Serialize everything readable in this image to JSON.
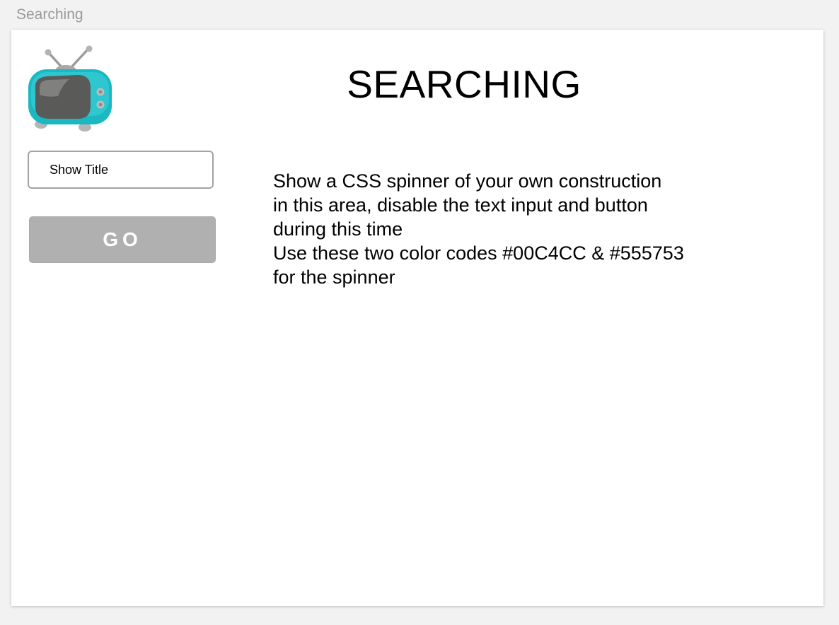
{
  "frame": {
    "label": "Searching"
  },
  "header": {
    "title": "SEARCHING",
    "logo_icon": "retro-tv-icon"
  },
  "search": {
    "placeholder": "Show Title",
    "value": "",
    "disabled": true
  },
  "go_button": {
    "label": "GO",
    "disabled": true
  },
  "main": {
    "instruction_lines": [
      "Show a CSS spinner of your own construction",
      "in this area, disable the text input and button",
      "during this time",
      "Use these two color codes #00C4CC & #555753",
      "for the spinner"
    ]
  },
  "colors": {
    "accent_cyan": "#00C4CC",
    "accent_gray": "#555753",
    "button_disabled": "#B0B0B0",
    "background": "#F2F2F2",
    "artboard": "#FFFFFF"
  }
}
